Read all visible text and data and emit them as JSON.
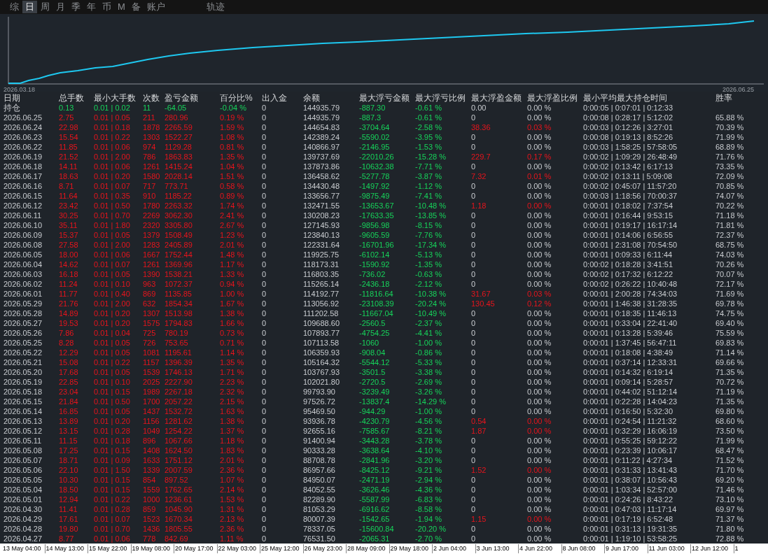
{
  "tabs": [
    {
      "label": "综",
      "selected": false
    },
    {
      "label": "日",
      "selected": true
    },
    {
      "label": "周",
      "selected": false
    },
    {
      "label": "月",
      "selected": false
    },
    {
      "label": "季",
      "selected": false
    },
    {
      "label": "年",
      "selected": false
    },
    {
      "label": "币",
      "selected": false
    },
    {
      "label": "M",
      "selected": false
    },
    {
      "label": "备",
      "selected": false
    },
    {
      "label": "账户",
      "selected": false
    },
    {
      "label": "轨迹",
      "selected": false
    }
  ],
  "chart": {
    "start_label": "2026.03.18",
    "end_label": "2026.06.25"
  },
  "table": {
    "columns": [
      "日期",
      "总手数",
      "最小大手数",
      "次数",
      "盈亏金额",
      "百分比%",
      "出入金",
      "余额",
      "最大浮亏金额",
      "最大浮亏比例",
      "最大浮盈金额",
      "最大浮盈比例",
      "最小平均最大持仓时间",
      "胜率"
    ],
    "rows": [
      {
        "kind": "position",
        "float_profit": false,
        "cells": [
          "持仓",
          "0.13",
          "0.01 | 0.02",
          "11",
          "-64.05",
          "-0.04 %",
          "0",
          "144935.79",
          "-887.30",
          "-0.61 %",
          "0.00",
          "0.00 %",
          "0:00:05 | 0:07:01 | 0:12:33"
        ]
      },
      {
        "kind": "day",
        "float_profit": false,
        "cells": [
          "2026.06.25",
          "2.75",
          "0.01 | 0.05",
          "211",
          "280.96",
          "0.19 %",
          "0",
          "144935.79",
          "-887.3",
          "-0.61 %",
          "0",
          "0.00 %",
          "0:00:08 | 0:28:17 | 5:12:02",
          "65.88 %"
        ]
      },
      {
        "kind": "day",
        "float_profit": true,
        "cells": [
          "2026.06.24",
          "22.98",
          "0.01 | 0.18",
          "1878",
          "2265.59",
          "1.59 %",
          "0",
          "144654.83",
          "-3704.64",
          "-2.58 %",
          "38.36",
          "0.03 %",
          "0:00:03 | 0:12:26 | 3:27:01",
          "70.39 %"
        ]
      },
      {
        "kind": "day",
        "float_profit": false,
        "cells": [
          "2026.06.23",
          "15.54",
          "0.01 | 0.22",
          "1303",
          "1522.27",
          "1.08 %",
          "0",
          "142389.24",
          "-5590.02",
          "-3.95 %",
          "0",
          "0.00 %",
          "0:00:08 | 0:19:13 | 8:52:26",
          "71.99 %"
        ]
      },
      {
        "kind": "day",
        "float_profit": false,
        "cells": [
          "2026.06.22",
          "11.85",
          "0.01 | 0.06",
          "974",
          "1129.28",
          "0.81 %",
          "0",
          "140866.97",
          "-2146.95",
          "-1.53 %",
          "0",
          "0.00 %",
          "0:00:03 | 1:58:25 | 57:58:05",
          "68.89 %"
        ]
      },
      {
        "kind": "day",
        "float_profit": true,
        "cells": [
          "2026.06.19",
          "21.52",
          "0.01 | 2.00",
          "786",
          "1863.83",
          "1.35 %",
          "0",
          "139737.69",
          "-22010.26",
          "-15.28 %",
          "229.7",
          "0.17 %",
          "0:00:02 | 1:09:29 | 26:48:49",
          "71.76 %"
        ]
      },
      {
        "kind": "day",
        "float_profit": false,
        "cells": [
          "2026.06.18",
          "14.11",
          "0.01 | 0.06",
          "1261",
          "1415.24",
          "1.04 %",
          "0",
          "137873.86",
          "-10632.38",
          "-7.71 %",
          "0",
          "0.00 %",
          "0:00:02 | 0:13:42 | 6:17:13",
          "73.35 %"
        ]
      },
      {
        "kind": "day",
        "float_profit": true,
        "cells": [
          "2026.06.17",
          "18.63",
          "0.01 | 0.20",
          "1580",
          "2028.14",
          "1.51 %",
          "0",
          "136458.62",
          "-5277.78",
          "-3.87 %",
          "7.32",
          "0.01 %",
          "0:00:02 | 0:13:11 | 5:09:08",
          "72.09 %"
        ]
      },
      {
        "kind": "day",
        "float_profit": false,
        "cells": [
          "2026.06.16",
          "8.71",
          "0.01 | 0.07",
          "717",
          "773.71",
          "0.58 %",
          "0",
          "134430.48",
          "-1497.92",
          "-1.12 %",
          "0",
          "0.00 %",
          "0:00:02 | 0:45:07 | 11:57:20",
          "70.85 %"
        ]
      },
      {
        "kind": "day",
        "float_profit": false,
        "cells": [
          "2026.06.15",
          "11.64",
          "0.01 | 0.35",
          "910",
          "1185.22",
          "0.89 %",
          "0",
          "133656.77",
          "-9875.49",
          "-7.41 %",
          "0",
          "0.00 %",
          "0:00:03 | 1:18:56 | 70:00:37",
          "74.07 %"
        ]
      },
      {
        "kind": "day",
        "float_profit": true,
        "cells": [
          "2026.06.12",
          "23.42",
          "0.01 | 0.50",
          "1780",
          "2263.32",
          "1.74 %",
          "0",
          "132471.55",
          "-13653.67",
          "-10.48 %",
          "1.18",
          "0.00 %",
          "0:00:01 | 0:18:02 | 7:37:54",
          "70.22 %"
        ]
      },
      {
        "kind": "day",
        "float_profit": false,
        "cells": [
          "2026.06.11",
          "30.25",
          "0.01 | 0.70",
          "2269",
          "3062.30",
          "2.41 %",
          "0",
          "130208.23",
          "-17633.35",
          "-13.85 %",
          "0",
          "0.00 %",
          "0:00:01 | 0:16:44 | 9:53:15",
          "71.18 %"
        ]
      },
      {
        "kind": "day",
        "float_profit": false,
        "cells": [
          "2026.06.10",
          "35.11",
          "0.01 | 1.80",
          "2320",
          "3305.80",
          "2.67 %",
          "0",
          "127145.93",
          "-9856.98",
          "-8.15 %",
          "0",
          "0.00 %",
          "0:00:01 | 0:19:17 | 16:17:14",
          "71.81 %"
        ]
      },
      {
        "kind": "day",
        "float_profit": false,
        "cells": [
          "2026.06.09",
          "15.37",
          "0.01 | 0.05",
          "1379",
          "1508.49",
          "1.23 %",
          "0",
          "123840.13",
          "-9605.59",
          "-7.76 %",
          "0",
          "0.00 %",
          "0:00:01 | 0:14:06 | 6:56:55",
          "72.37 %"
        ]
      },
      {
        "kind": "day",
        "float_profit": false,
        "cells": [
          "2026.06.08",
          "27.58",
          "0.01 | 2.00",
          "1283",
          "2405.89",
          "2.01 %",
          "0",
          "122331.64",
          "-16701.96",
          "-17.34 %",
          "0",
          "0.00 %",
          "0:00:01 | 2:31:08 | 70:54:50",
          "68.75 %"
        ]
      },
      {
        "kind": "day",
        "float_profit": false,
        "cells": [
          "2026.06.05",
          "18.00",
          "0.01 | 0.06",
          "1667",
          "1752.44",
          "1.48 %",
          "0",
          "119925.75",
          "-6102.14",
          "-5.13 %",
          "0",
          "0.00 %",
          "0:00:01 | 0:09:33 | 6:11:44",
          "74.03 %"
        ]
      },
      {
        "kind": "day",
        "float_profit": false,
        "cells": [
          "2026.06.04",
          "14.62",
          "0.01 | 0.07",
          "1261",
          "1369.96",
          "1.17 %",
          "0",
          "118173.31",
          "-1590.92",
          "-1.35 %",
          "0",
          "0.00 %",
          "0:00:02 | 0:18:28 | 3:41:51",
          "70.26 %"
        ]
      },
      {
        "kind": "day",
        "float_profit": false,
        "cells": [
          "2026.06.03",
          "16.18",
          "0.01 | 0.05",
          "1390",
          "1538.21",
          "1.33 %",
          "0",
          "116803.35",
          "-736.02",
          "-0.63 %",
          "0",
          "0.00 %",
          "0:00:02 | 0:17:32 | 6:12:22",
          "70.07 %"
        ]
      },
      {
        "kind": "day",
        "float_profit": false,
        "cells": [
          "2026.06.02",
          "11.24",
          "0.01 | 0.10",
          "963",
          "1072.37",
          "0.94 %",
          "0",
          "115265.14",
          "-2436.18",
          "-2.12 %",
          "0",
          "0.00 %",
          "0:00:02 | 0:26:22 | 10:40:48",
          "72.17 %"
        ]
      },
      {
        "kind": "day",
        "float_profit": true,
        "cells": [
          "2026.06.01",
          "11.77",
          "0.01 | 0.40",
          "869",
          "1135.85",
          "1.00 %",
          "0",
          "114192.77",
          "-11816.64",
          "-10.38 %",
          "31.67",
          "0.03 %",
          "0:00:01 | 2:00:28 | 74:34:03",
          "71.69 %"
        ]
      },
      {
        "kind": "day",
        "float_profit": true,
        "cells": [
          "2026.05.29",
          "21.76",
          "0.01 | 2.00",
          "632",
          "1854.34",
          "1.67 %",
          "0",
          "113056.92",
          "-23108.39",
          "-20.24 %",
          "130.45",
          "0.12 %",
          "0:00:01 | 1:46:38 | 31:28:35",
          "69.78 %"
        ]
      },
      {
        "kind": "day",
        "float_profit": false,
        "cells": [
          "2026.05.28",
          "14.89",
          "0.01 | 0.20",
          "1307",
          "1513.98",
          "1.38 %",
          "0",
          "111202.58",
          "-11667.04",
          "-10.49 %",
          "0",
          "0.00 %",
          "0:00:01 | 0:18:35 | 11:46:13",
          "74.75 %"
        ]
      },
      {
        "kind": "day",
        "float_profit": false,
        "cells": [
          "2026.05.27",
          "19.53",
          "0.01 | 0.20",
          "1575",
          "1794.83",
          "1.66 %",
          "0",
          "109688.60",
          "-2560.5",
          "-2.37 %",
          "0",
          "0.00 %",
          "0:00:01 | 0:33:04 | 22:41:40",
          "69.40 %"
        ]
      },
      {
        "kind": "day",
        "float_profit": false,
        "cells": [
          "2026.05.26",
          "7.86",
          "0.01 | 0.04",
          "725",
          "780.19",
          "0.73 %",
          "0",
          "107893.77",
          "-4754.25",
          "-4.41 %",
          "0",
          "0.00 %",
          "0:00:01 | 0:13:28 | 5:39:46",
          "75.59 %"
        ]
      },
      {
        "kind": "day",
        "float_profit": false,
        "cells": [
          "2026.05.25",
          "8.28",
          "0.01 | 0.05",
          "726",
          "753.65",
          "0.71 %",
          "0",
          "107113.58",
          "-1060",
          "-1.00 %",
          "0",
          "0.00 %",
          "0:00:01 | 1:37:45 | 56:47:11",
          "69.83 %"
        ]
      },
      {
        "kind": "day",
        "float_profit": false,
        "cells": [
          "2026.05.22",
          "12.29",
          "0.01 | 0.05",
          "1081",
          "1195.61",
          "1.14 %",
          "0",
          "106359.93",
          "-908.04",
          "-0.86 %",
          "0",
          "0.00 %",
          "0:00:01 | 0:18:08 | 4:38:49",
          "71.14 %"
        ]
      },
      {
        "kind": "day",
        "float_profit": false,
        "cells": [
          "2026.05.21",
          "15.08",
          "0.01 | 0.22",
          "1157",
          "1396.39",
          "1.35 %",
          "0",
          "105164.32",
          "-5544.12",
          "-5.33 %",
          "0",
          "0.00 %",
          "0:00:01 | 0:37:14 | 12:33:31",
          "69.66 %"
        ]
      },
      {
        "kind": "day",
        "float_profit": false,
        "cells": [
          "2026.05.20",
          "17.68",
          "0.01 | 0.05",
          "1539",
          "1746.13",
          "1.71 %",
          "0",
          "103767.93",
          "-3501.5",
          "-3.38 %",
          "0",
          "0.00 %",
          "0:00:01 | 0:14:32 | 6:19:14",
          "71.35 %"
        ]
      },
      {
        "kind": "day",
        "float_profit": false,
        "cells": [
          "2026.05.19",
          "22.85",
          "0.01 | 0.10",
          "2025",
          "2227.90",
          "2.23 %",
          "0",
          "102021.80",
          "-2720.5",
          "-2.69 %",
          "0",
          "0.00 %",
          "0:00:01 | 0:09:14 | 5:28:57",
          "70.72 %"
        ]
      },
      {
        "kind": "day",
        "float_profit": false,
        "cells": [
          "2026.05.18",
          "23.04",
          "0.01 | 0.15",
          "1989",
          "2267.18",
          "2.32 %",
          "0",
          "99793.90",
          "-3239.49",
          "-3.26 %",
          "0",
          "0.00 %",
          "0:00:01 | 0:44:02 | 51:12:14",
          "71.19 %"
        ]
      },
      {
        "kind": "day",
        "float_profit": false,
        "cells": [
          "2026.05.15",
          "21.84",
          "0.01 | 0.50",
          "1700",
          "2057.22",
          "2.15 %",
          "0",
          "97526.72",
          "-13837.4",
          "-14.29 %",
          "0",
          "0.00 %",
          "0:00:01 | 0:22:28 | 14:04:23",
          "71.35 %"
        ]
      },
      {
        "kind": "day",
        "float_profit": false,
        "cells": [
          "2026.05.14",
          "16.85",
          "0.01 | 0.05",
          "1437",
          "1532.72",
          "1.63 %",
          "0",
          "95469.50",
          "-944.29",
          "-1.00 %",
          "0",
          "0.00 %",
          "0:00:01 | 0:16:50 | 5:32:30",
          "69.80 %"
        ]
      },
      {
        "kind": "day",
        "float_profit": true,
        "cells": [
          "2026.05.13",
          "13.89",
          "0.01 | 0.20",
          "1156",
          "1281.62",
          "1.38 %",
          "0",
          "93936.78",
          "-4230.79",
          "-4.56 %",
          "0.54",
          "0.00 %",
          "0:00:01 | 0:24:54 | 11:21:32",
          "68.60 %"
        ]
      },
      {
        "kind": "day",
        "float_profit": true,
        "cells": [
          "2026.05.12",
          "13.15",
          "0.01 | 0.28",
          "1049",
          "1254.22",
          "1.37 %",
          "0",
          "92655.16",
          "-7585.67",
          "-8.21 %",
          "1.87",
          "0.00 %",
          "0:00:01 | 0:32:29 | 16:06:19",
          "73.50 %"
        ]
      },
      {
        "kind": "day",
        "float_profit": false,
        "cells": [
          "2026.05.11",
          "11.15",
          "0.01 | 0.18",
          "896",
          "1067.66",
          "1.18 %",
          "0",
          "91400.94",
          "-3443.28",
          "-3.78 %",
          "0",
          "0.00 %",
          "0:00:01 | 0:55:25 | 59:12:22",
          "71.99 %"
        ]
      },
      {
        "kind": "day",
        "float_profit": false,
        "cells": [
          "2026.05.08",
          "17.25",
          "0.01 | 0.15",
          "1408",
          "1624.50",
          "1.83 %",
          "0",
          "90333.28",
          "-3638.64",
          "-4.10 %",
          "0",
          "0.00 %",
          "0:00:01 | 0:23:39 | 10:06:17",
          "68.47 %"
        ]
      },
      {
        "kind": "day",
        "float_profit": false,
        "cells": [
          "2026.05.07",
          "18.71",
          "0.01 | 0.09",
          "1633",
          "1751.12",
          "2.01 %",
          "0",
          "88708.78",
          "-2841.96",
          "-3.20 %",
          "0",
          "0.00 %",
          "0:00:01 | 0:11:22 | 4:27:34",
          "71.52 %"
        ]
      },
      {
        "kind": "day",
        "float_profit": true,
        "cells": [
          "2026.05.06",
          "22.10",
          "0.01 | 1.50",
          "1339",
          "2007.59",
          "2.36 %",
          "0",
          "86957.66",
          "-8425.12",
          "-9.21 %",
          "1.52",
          "0.00 %",
          "0:00:01 | 0:31:33 | 13:41:43",
          "71.70 %"
        ]
      },
      {
        "kind": "day",
        "float_profit": false,
        "cells": [
          "2026.05.05",
          "10.30",
          "0.01 | 0.15",
          "854",
          "897.52",
          "1.07 %",
          "0",
          "84950.07",
          "-2471.19",
          "-2.94 %",
          "0",
          "0.00 %",
          "0:00:01 | 0:38:07 | 10:56:43",
          "69.20 %"
        ]
      },
      {
        "kind": "day",
        "float_profit": false,
        "cells": [
          "2026.05.04",
          "18.50",
          "0.01 | 0.15",
          "1559",
          "1762.65",
          "2.14 %",
          "0",
          "84052.55",
          "-3626.46",
          "-4.36 %",
          "0",
          "0.00 %",
          "0:00:01 | 1:03:34 | 52:57:00",
          "71.46 %"
        ]
      },
      {
        "kind": "day",
        "float_profit": false,
        "cells": [
          "2026.05.01",
          "12.94",
          "0.01 | 0.22",
          "1000",
          "1236.61",
          "1.53 %",
          "0",
          "82289.90",
          "-5587.99",
          "-6.83 %",
          "0",
          "0.00 %",
          "0:00:01 | 0:24:26 | 8:43:22",
          "73.10 %"
        ]
      },
      {
        "kind": "day",
        "float_profit": false,
        "cells": [
          "2026.04.30",
          "11.41",
          "0.01 | 0.28",
          "859",
          "1045.90",
          "1.31 %",
          "0",
          "81053.29",
          "-6916.62",
          "-8.58 %",
          "0",
          "0.00 %",
          "0:00:01 | 0:47:03 | 11:17:14",
          "69.97 %"
        ]
      },
      {
        "kind": "day",
        "float_profit": true,
        "cells": [
          "2026.04.29",
          "17.61",
          "0.01 | 0.07",
          "1523",
          "1670.34",
          "2.13 %",
          "0",
          "80007.39",
          "-1542.65",
          "-1.94 %",
          "1.15",
          "0.00 %",
          "0:00:01 | 0:17:19 | 6:52:48",
          "71.37 %"
        ]
      },
      {
        "kind": "day",
        "float_profit": false,
        "cells": [
          "2026.04.28",
          "19.80",
          "0.01 | 0.70",
          "1436",
          "1805.55",
          "2.36 %",
          "0",
          "78337.05",
          "-15600.84",
          "-20.20 %",
          "0",
          "0.00 %",
          "0:00:01 | 0:31:13 | 19:31:35",
          "71.80 %"
        ]
      },
      {
        "kind": "day",
        "float_profit": false,
        "cells": [
          "2026.04.27",
          "8.77",
          "0.01 | 0.06",
          "778",
          "842.69",
          "1.11 %",
          "0",
          "76531.50",
          "-2065.31",
          "-2.70 %",
          "0",
          "0.00 %",
          "0:00:01 | 1:19:10 | 53:58:25",
          "72.88 %"
        ]
      }
    ]
  },
  "timeline": [
    "13 May 04:00",
    "14 May 13:00",
    "15 May 22:00",
    "19 May 08:00",
    "20 May 17:00",
    "22 May 03:00",
    "25 May 12:00",
    "26 May 23:00",
    "28 May 09:00",
    "29 May 18:00",
    "2 Jun 04:00",
    "3 Jun 13:00",
    "4 Jun 22:00",
    "8 Jun 08:00",
    "9 Jun 17:00",
    "11 Jun 03:00",
    "12 Jun 12:00",
    "1"
  ]
}
